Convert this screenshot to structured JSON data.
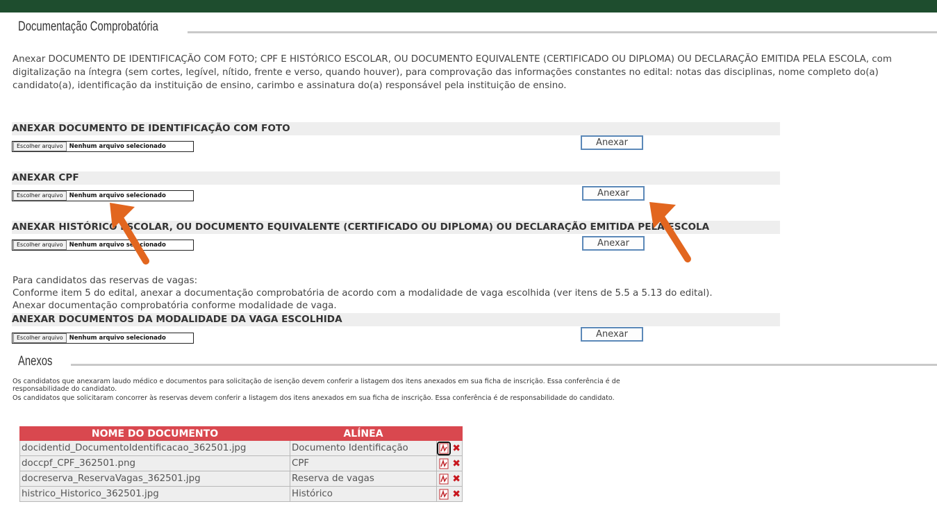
{
  "section1": {
    "title": "Documentação Comprobatória",
    "intro": "Anexar DOCUMENTO DE IDENTIFICAÇÃO COM FOTO; CPF E HISTÓRICO ESCOLAR, OU DOCUMENTO EQUIVALENTE (CERTIFICADO OU DIPLOMA) OU DECLARAÇÃO EMITIDA PELA ESCOLA, com digitalização na íntegra (sem cortes, legível, nítido, frente e verso, quando houver), para comprovação das informações constantes no edital: notas das disciplinas, nome completo do(a) candidato(a), identificação da instituição de ensino, carimbo e assinatura do(a) responsável pela instituição de ensino."
  },
  "uploads": [
    {
      "label": "ANEXAR DOCUMENTO DE IDENTIFICAÇÃO COM FOTO",
      "choose_label": "Escolher arquivo",
      "file_status": "Nenhum arquivo selecionado",
      "button": "Anexar"
    },
    {
      "label": "ANEXAR CPF",
      "choose_label": "Escolher arquivo",
      "file_status": "Nenhum arquivo selecionado",
      "button": "Anexar"
    },
    {
      "label": "ANEXAR HISTÓRICO ESCOLAR, OU DOCUMENTO EQUIVALENTE (CERTIFICADO OU DIPLOMA) OU DECLARAÇÃO EMITIDA PELA ESCOLA",
      "choose_label": "Escolher arquivo",
      "file_status": "Nenhum arquivo selecionado",
      "button": "Anexar"
    },
    {
      "label": "ANEXAR DOCUMENTOS DA MODALIDADE DA VAGA ESCOLHIDA",
      "choose_label": "Escolher arquivo",
      "file_status": "Nenhum arquivo selecionado",
      "button": "Anexar"
    }
  ],
  "reserva": {
    "line1": "Para candidatos das reservas de vagas:",
    "line2": "Conforme item 5 do edital, anexar a documentação comprobatória de acordo com a modalidade de vaga escolhida (ver itens de 5.5 a 5.13 do edital).",
    "line3": "Anexar documentação comprobatória conforme modalidade de vaga."
  },
  "section2": {
    "title": "Anexos",
    "note1": "Os candidatos que anexaram laudo médico e documentos para solicitação de isenção devem conferir a listagem dos itens anexados em sua ficha de inscrição. Essa conferência é de responsabilidade do candidato.",
    "note2": "Os candidatos que solicitaram concorrer às reservas devem conferir a listagem dos itens anexados em sua ficha de inscrição. Essa conferência é de responsabilidade do candidato."
  },
  "table": {
    "headers": [
      "NOME DO DOCUMENTO",
      "ALÍNEA"
    ],
    "rows": [
      {
        "name": "docidentid_DocumentoIdentificacao_362501.jpg",
        "alinea": "Documento Identificação"
      },
      {
        "name": "doccpf_CPF_362501.png",
        "alinea": "CPF"
      },
      {
        "name": "docreserva_ReservaVagas_362501.jpg",
        "alinea": "Reserva de vagas"
      },
      {
        "name": "histrico_Historico_362501.jpg",
        "alinea": "Histórico"
      }
    ]
  },
  "colors": {
    "page_border": "#1e4d2e",
    "table_header": "#d9484f",
    "button_border": "#5b88b8",
    "arrow": "#e2661f",
    "delete_icon": "#c8161d"
  },
  "icons": [
    "pdf-icon",
    "delete-icon",
    "arrow-annotation"
  ]
}
